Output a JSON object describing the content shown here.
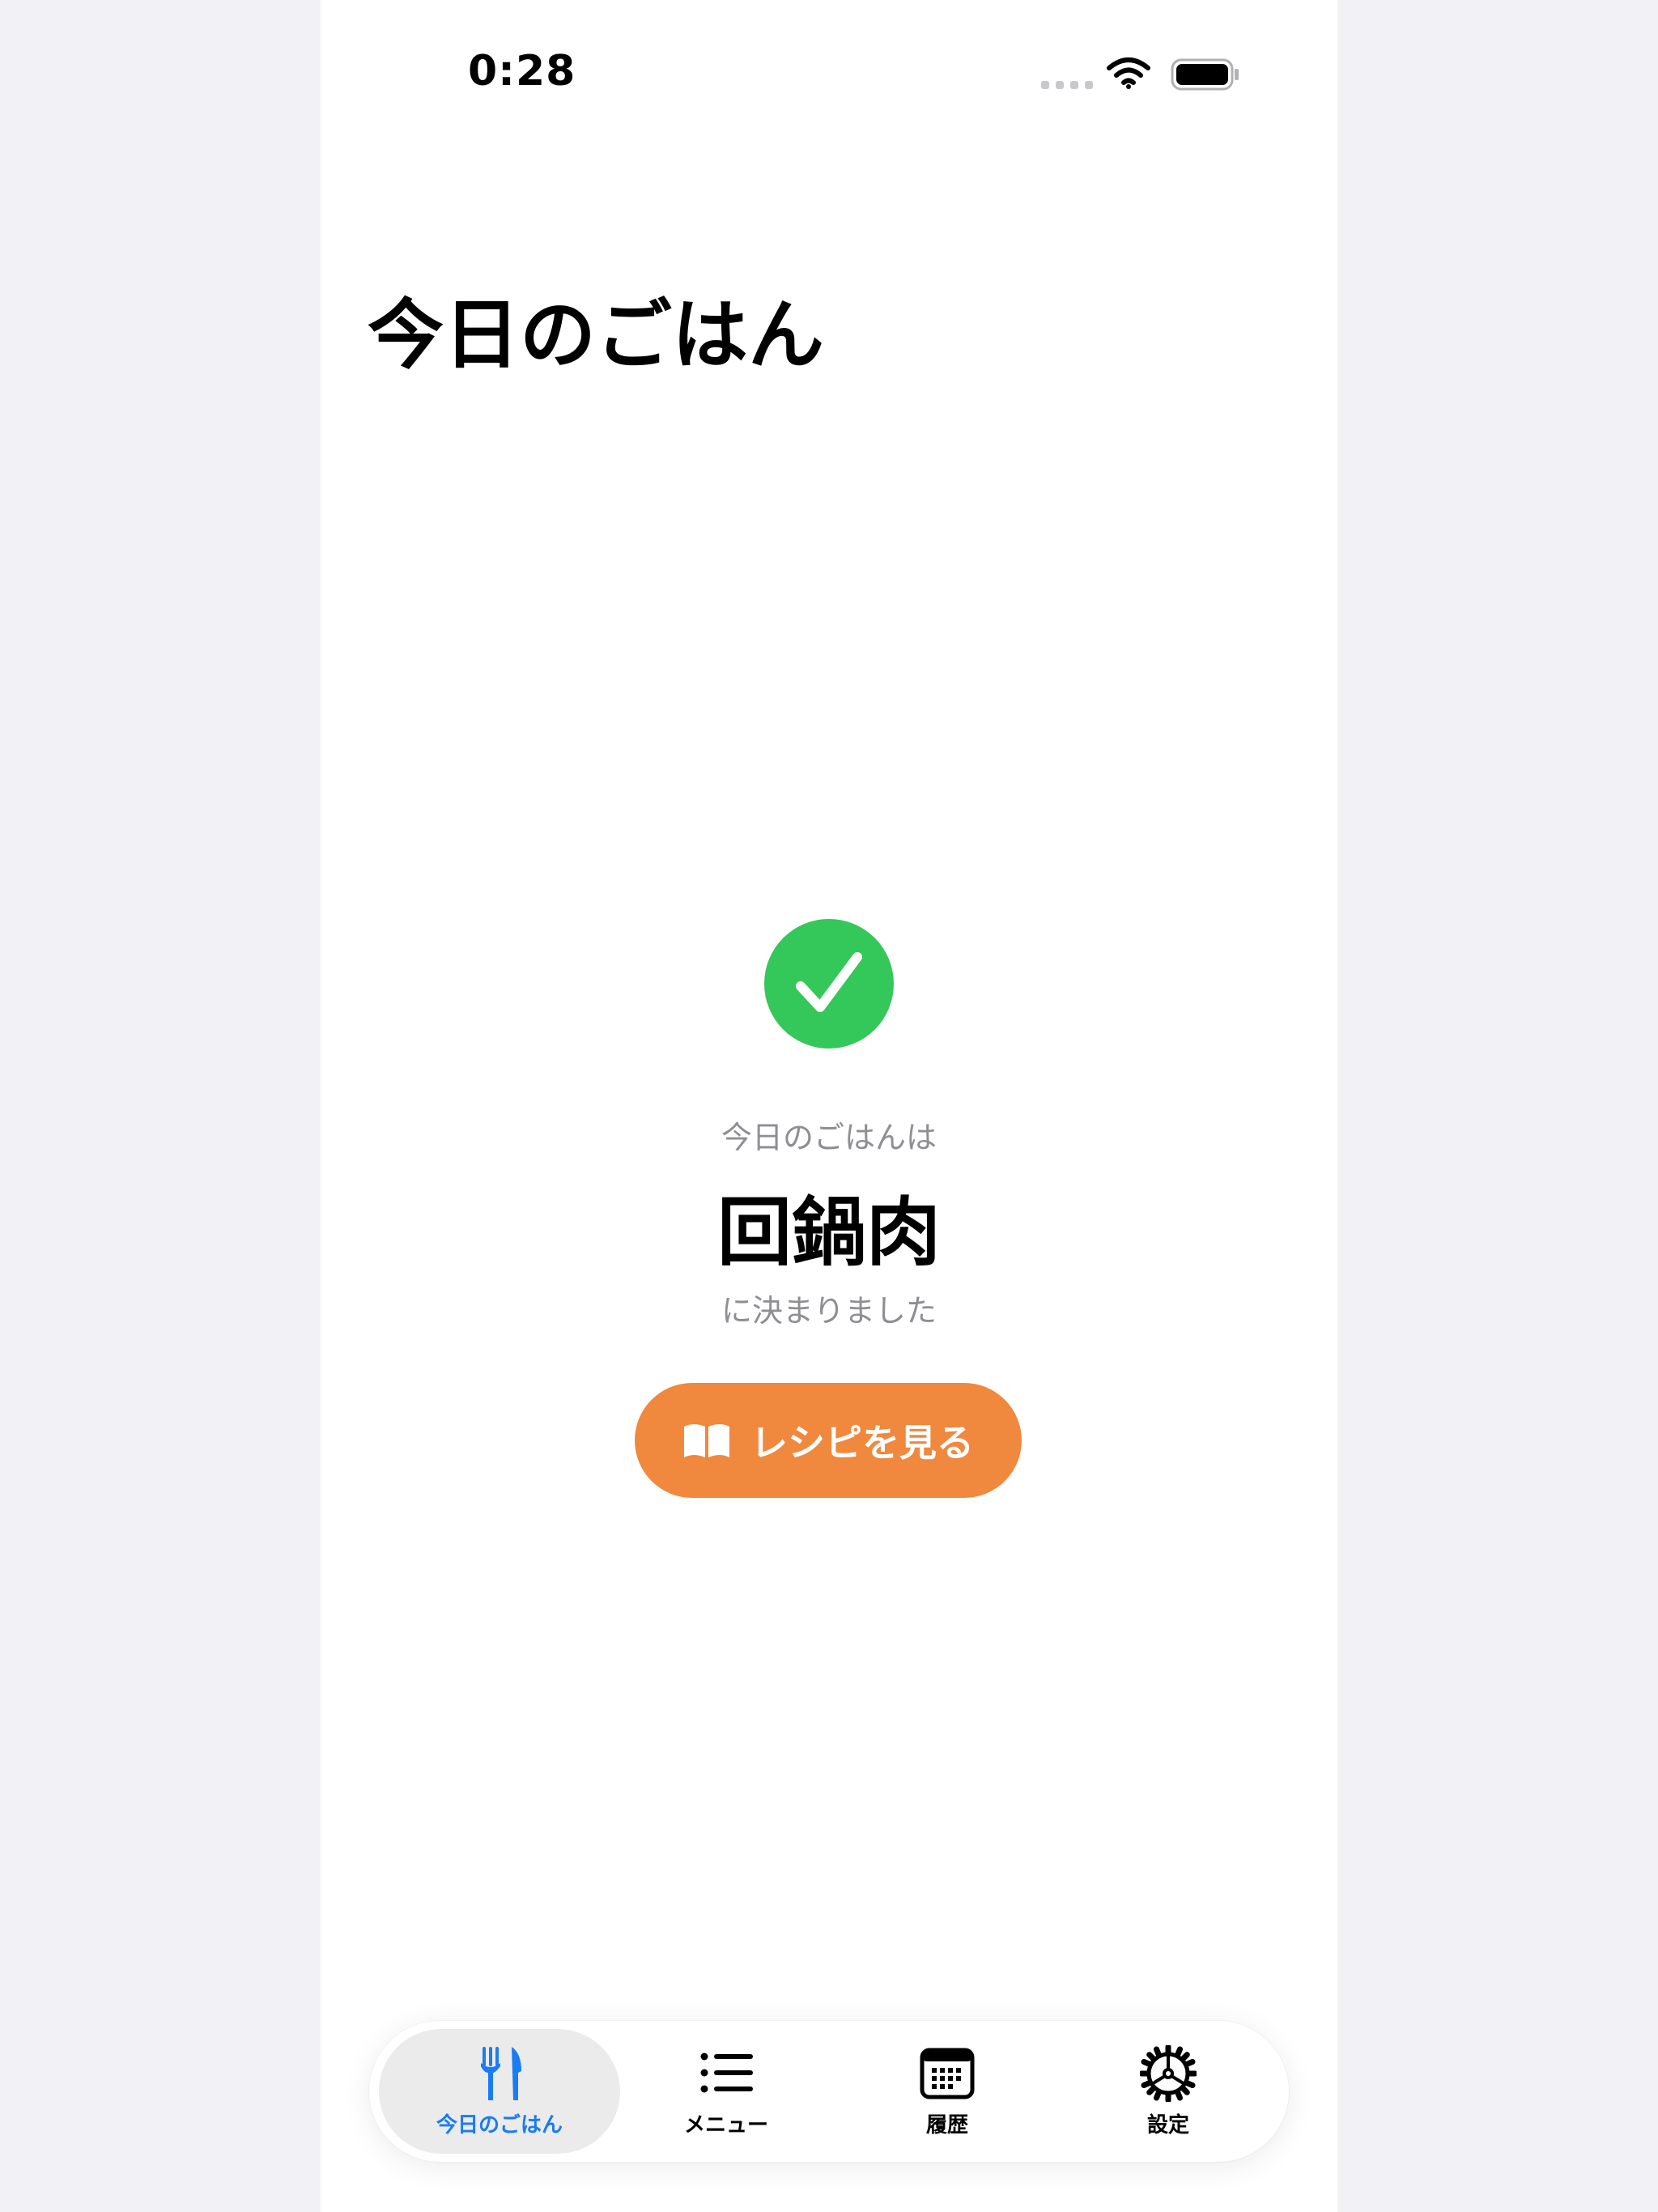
{
  "status_bar": {
    "time": "0:28"
  },
  "header": {
    "title": "今日のごはん"
  },
  "result": {
    "pre_label": "今日のごはんは",
    "dish": "回鍋肉",
    "post_label": "に決まりました",
    "status_icon": "checkmark-circle-icon",
    "status_color": "#34c759"
  },
  "recipe_button": {
    "label": "レシピを見る",
    "icon": "book-icon",
    "color": "#f0883e"
  },
  "tab_bar": {
    "active_color": "#1a7cf2",
    "tabs": [
      {
        "label": "今日のごはん",
        "icon": "fork-knife-icon",
        "active": true
      },
      {
        "label": "メニュー",
        "icon": "list-icon",
        "active": false
      },
      {
        "label": "履歴",
        "icon": "calendar-icon",
        "active": false
      },
      {
        "label": "設定",
        "icon": "gear-icon",
        "active": false
      }
    ]
  }
}
